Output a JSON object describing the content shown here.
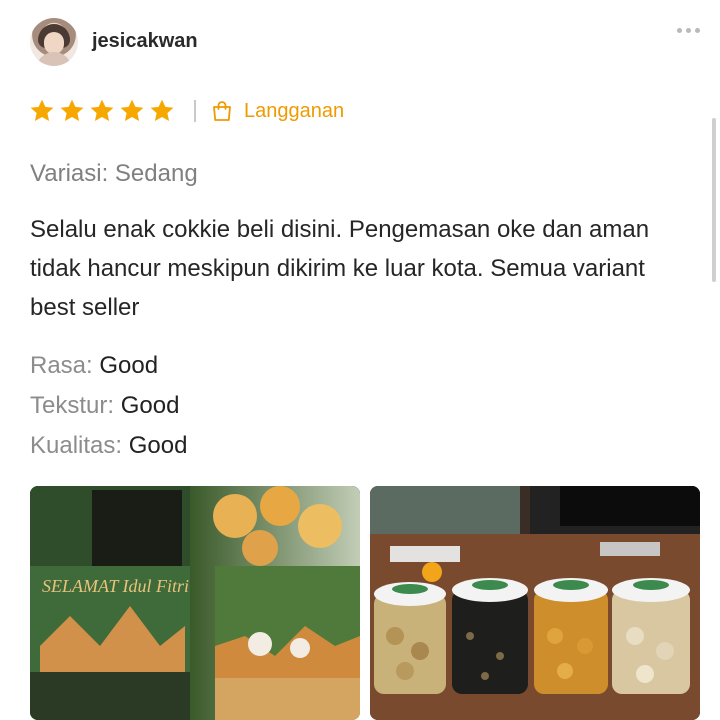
{
  "user": {
    "name": "jesicakwan"
  },
  "rating": {
    "stars": 5,
    "max": 5
  },
  "purchase": {
    "label": "Langganan"
  },
  "variation": "Variasi: Sedang",
  "review": "Selalu enak cokkie beli disini. Pengemasan oke dan aman tidak hancur meskipun dikirim ke luar kota. Semua variant best seller",
  "attributes": [
    {
      "name": "Rasa:",
      "value": "Good"
    },
    {
      "name": "Tekstur:",
      "value": "Good"
    },
    {
      "name": "Kualitas:",
      "value": "Good"
    }
  ],
  "photos": [
    {
      "label_text": "SELAMAT Idul Fitri"
    },
    {
      "label_text": ""
    }
  ],
  "colors": {
    "star": "#f6a800",
    "accent": "#ee9b00",
    "text": "#222222",
    "muted": "#8c8c8c"
  }
}
